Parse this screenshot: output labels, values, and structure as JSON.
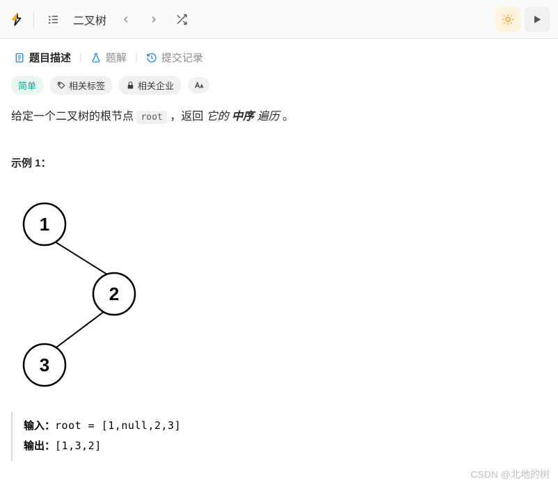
{
  "header": {
    "crumb": "二叉树"
  },
  "tabs": {
    "description": "题目描述",
    "solution": "题解",
    "submissions": "提交记录"
  },
  "pills": {
    "difficulty": "简单",
    "tags": "相关标签",
    "companies": "相关企业"
  },
  "description": {
    "pre": "给定一个二叉树的根节点 ",
    "code": "root",
    "mid": " ，返回 ",
    "italic1": "它的 ",
    "bolditalic": "中序",
    "italic2": " 遍历",
    "post": " 。"
  },
  "example": {
    "title": "示例 1：",
    "input_label": "输入：",
    "input_value": "root = [1,null,2,3]",
    "output_label": "输出：",
    "output_value": "[1,3,2]"
  },
  "tree": {
    "nodes": [
      "1",
      "2",
      "3"
    ]
  },
  "watermark": "CSDN @北地的树"
}
